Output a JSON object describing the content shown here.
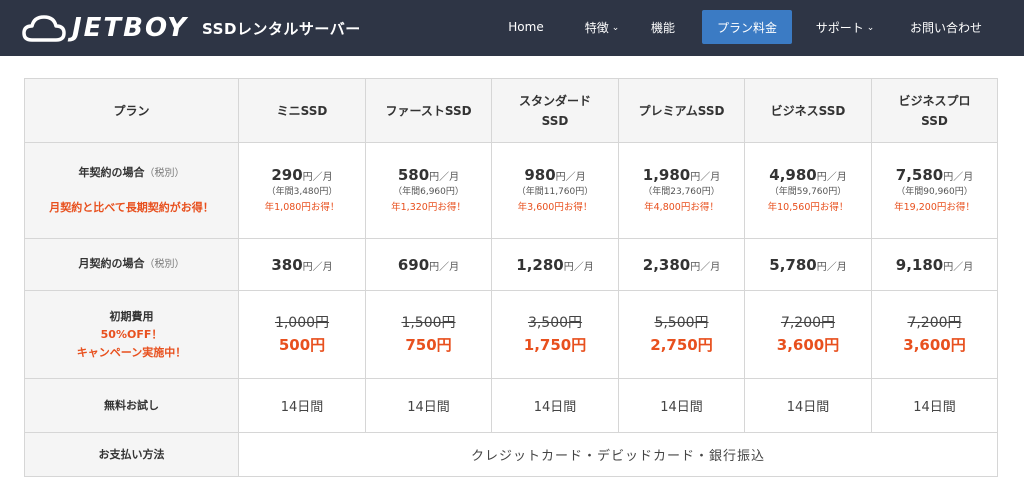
{
  "header": {
    "logo_text": "JETBOY",
    "logo_sub": "SSDレンタルサーバー",
    "nav": [
      {
        "label": "Home",
        "dropdown": false
      },
      {
        "label": "特徴",
        "dropdown": true
      },
      {
        "label": "機能",
        "dropdown": false
      },
      {
        "label": "プラン料金",
        "dropdown": false,
        "active": true
      },
      {
        "label": "サポート",
        "dropdown": true
      },
      {
        "label": "お問い合わせ",
        "dropdown": false
      }
    ]
  },
  "table": {
    "corner": "プラン",
    "plans": [
      {
        "line1": "ミニSSD",
        "line2": ""
      },
      {
        "line1": "ファーストSSD",
        "line2": ""
      },
      {
        "line1": "スタンダード",
        "line2": "SSD"
      },
      {
        "line1": "プレミアムSSD",
        "line2": ""
      },
      {
        "line1": "ビジネスSSD",
        "line2": ""
      },
      {
        "line1": "ビジネスプロ",
        "line2": "SSD"
      }
    ],
    "annual_row": {
      "label": "年契約の場合",
      "label_note": "（税別）",
      "label_red": "月契約と比べて長期契約がお得！",
      "cells": [
        {
          "price": "290",
          "unit": "円／月",
          "annual": "（年間3,480円）",
          "saving": "年1,080円お得！"
        },
        {
          "price": "580",
          "unit": "円／月",
          "annual": "（年間6,960円）",
          "saving": "年1,320円お得！"
        },
        {
          "price": "980",
          "unit": "円／月",
          "annual": "（年間11,760円）",
          "saving": "年3,600円お得！"
        },
        {
          "price": "1,980",
          "unit": "円／月",
          "annual": "（年間23,760円）",
          "saving": "年4,800円お得！"
        },
        {
          "price": "4,980",
          "unit": "円／月",
          "annual": "（年間59,760円）",
          "saving": "年10,560円お得！"
        },
        {
          "price": "7,580",
          "unit": "円／月",
          "annual": "（年間90,960円）",
          "saving": "年19,200円お得！"
        }
      ]
    },
    "monthly_row": {
      "label": "月契約の場合",
      "label_note": "（税別）",
      "cells": [
        {
          "price": "380",
          "unit": "円／月"
        },
        {
          "price": "690",
          "unit": "円／月"
        },
        {
          "price": "1,280",
          "unit": "円／月"
        },
        {
          "price": "2,380",
          "unit": "円／月"
        },
        {
          "price": "5,780",
          "unit": "円／月"
        },
        {
          "price": "9,180",
          "unit": "円／月"
        }
      ]
    },
    "setup_row": {
      "label": "初期費用",
      "label_red1": "50%OFF！",
      "label_red2": "キャンペーン実施中！",
      "cells": [
        {
          "old": "1,000円",
          "new": "500円"
        },
        {
          "old": "1,500円",
          "new": "750円"
        },
        {
          "old": "3,500円",
          "new": "1,750円"
        },
        {
          "old": "5,500円",
          "new": "2,750円"
        },
        {
          "old": "7,200円",
          "new": "3,600円"
        },
        {
          "old": "7,200円",
          "new": "3,600円"
        }
      ]
    },
    "trial_row": {
      "label": "無料お試し",
      "cells": [
        "14日間",
        "14日間",
        "14日間",
        "14日間",
        "14日間",
        "14日間"
      ]
    },
    "payment_row": {
      "label": "お支払い方法",
      "value": "クレジットカード・デビッドカード・銀行振込"
    }
  },
  "colors": {
    "header_bg": "#2e3545",
    "active_nav": "#3b7bc4",
    "accent_red": "#e8501e"
  }
}
